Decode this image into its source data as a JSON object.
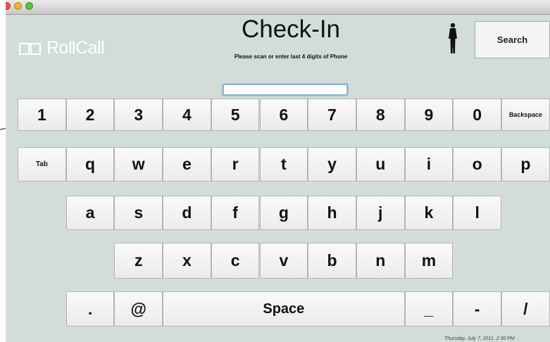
{
  "app": {
    "logo_text": "RollCall",
    "title": "Check-In",
    "subtitle": "Please scan or enter last 4 digits of Phone",
    "search_label": "Search",
    "entry_value": "",
    "footer_datetime": "Thursday, July 7, 2011, 2:30 PM"
  },
  "keyboard": {
    "row1": [
      "1",
      "2",
      "3",
      "4",
      "5",
      "6",
      "7",
      "8",
      "9",
      "0",
      "Backspace"
    ],
    "row2": [
      "Tab",
      "q",
      "w",
      "e",
      "r",
      "t",
      "y",
      "u",
      "i",
      "o",
      "p"
    ],
    "row3": [
      "a",
      "s",
      "d",
      "f",
      "g",
      "h",
      "j",
      "k",
      "l"
    ],
    "row4": [
      "z",
      "x",
      "c",
      "v",
      "b",
      "n",
      "m"
    ],
    "row5": [
      ".",
      "@",
      "Space",
      "_",
      "-",
      "/"
    ]
  },
  "colors": {
    "background": "#d3ddd8",
    "key_face": "#f4f4f4",
    "key_border": "#b4b4b4",
    "entry_focus": "#8fb2dd",
    "logo": "#ffffff"
  },
  "icons": [
    "close-dot",
    "minimize-dot",
    "zoom-dot",
    "rollcall-logo-icon",
    "person-icon"
  ]
}
